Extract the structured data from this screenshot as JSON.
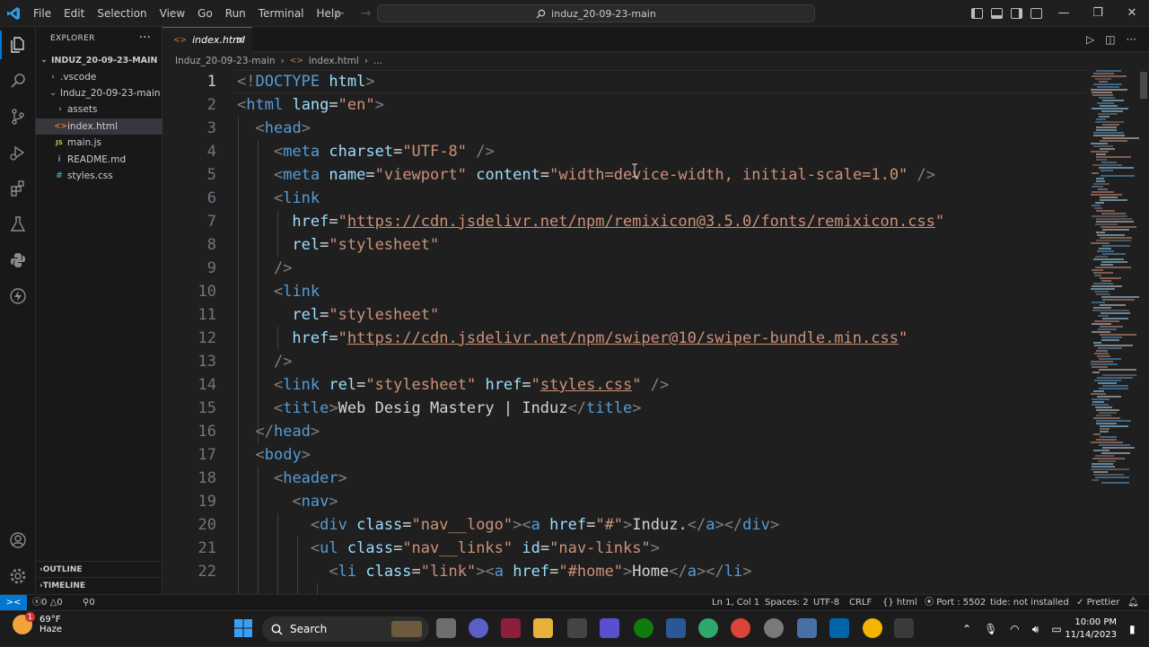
{
  "titlebar": {
    "menu": [
      "File",
      "Edit",
      "Selection",
      "View",
      "Go",
      "Run",
      "Terminal",
      "Help"
    ],
    "search_text": "induz_20-09-23-main"
  },
  "sidebar": {
    "header": "EXPLORER",
    "root": "INDUZ_20-09-23-MAIN",
    "items": [
      {
        "label": ".vscode",
        "type": "folder",
        "chevron": "›"
      },
      {
        "label": "Induz_20-09-23-main",
        "type": "folder",
        "chevron": "⌄"
      },
      {
        "label": "assets",
        "type": "folder",
        "chevron": "›"
      },
      {
        "label": "index.html",
        "type": "html",
        "icon": "<>"
      },
      {
        "label": "main.js",
        "type": "js",
        "icon": "JS"
      },
      {
        "label": "README.md",
        "type": "md",
        "icon": "i"
      },
      {
        "label": "styles.css",
        "type": "css",
        "icon": "#"
      }
    ],
    "outline": "OUTLINE",
    "timeline": "TIMELINE"
  },
  "tab": {
    "label": "index.html"
  },
  "breadcrumb": {
    "folder": "Induz_20-09-23-main",
    "file": "index.html",
    "rest": "..."
  },
  "editor": {
    "line_numbers": [
      "1",
      "2",
      "3",
      "4",
      "5",
      "6",
      "7",
      "8",
      "9",
      "10",
      "11",
      "12",
      "13",
      "14",
      "15",
      "16",
      "17",
      "18",
      "19",
      "20",
      "21",
      "22"
    ]
  },
  "statusbar": {
    "errors": "0",
    "warnings": "0",
    "ports": "0",
    "position": "Ln 1, Col 1",
    "spaces": "Spaces: 2",
    "encoding": "UTF-8",
    "eol": "CRLF",
    "language": "html",
    "port": "Port : 5502",
    "lint": "tide: not installed",
    "prettier": "Prettier"
  },
  "taskbar": {
    "temperature": "69°F",
    "weather": "Haze",
    "search": "Search",
    "time": "10:00 PM",
    "date": "11/14/2023",
    "weather_badge": "1"
  },
  "colors": {
    "accent": "#0078d4",
    "tag": "#569cd6",
    "attribute": "#9cdcfe",
    "string": "#ce9178",
    "bracket": "#808080"
  }
}
